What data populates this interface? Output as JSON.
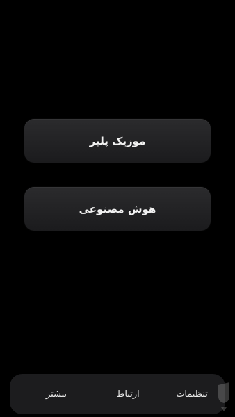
{
  "menu": {
    "music_player_label": "موزیک پلیر",
    "ai_label": "هوش مصنوعی"
  },
  "bottom_nav": {
    "more_label": "بیشتر",
    "contact_label": "ارتباط",
    "settings_label": "تنظیمات"
  },
  "colors": {
    "background": "#000000",
    "card": "#242426",
    "nav_bar": "#1c1c1e"
  }
}
